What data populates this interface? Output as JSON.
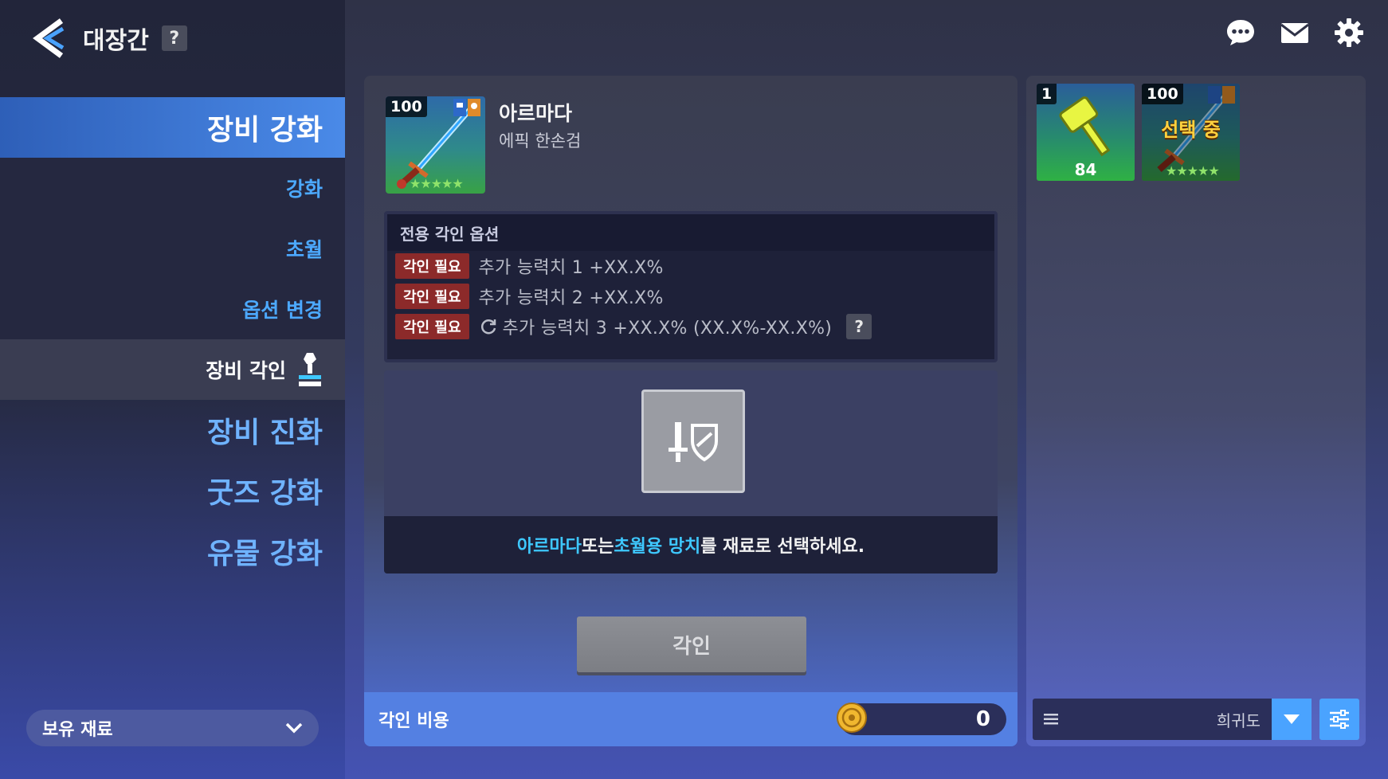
{
  "header": {
    "title": "대장간",
    "help": "?"
  },
  "sidebar": {
    "menu": [
      {
        "label": "장비 강화"
      },
      {
        "label": "강화"
      },
      {
        "label": "초월"
      },
      {
        "label": "옵션 변경"
      },
      {
        "label": "장비 각인"
      },
      {
        "label": "장비 진화"
      },
      {
        "label": "굿즈 강화"
      },
      {
        "label": "유물 강화"
      }
    ],
    "materials_label": "보유 재료"
  },
  "item": {
    "level": "100",
    "name": "아르마다",
    "type": "에픽 한손검",
    "stars": "★★★★★"
  },
  "options": {
    "header": "전용 각인 옵션",
    "rows": [
      {
        "tag": "각인 필요",
        "text": "추가 능력치 1  +XX.X%"
      },
      {
        "tag": "각인 필요",
        "text": "추가 능력치 2  +XX.X%"
      },
      {
        "tag": "각인 필요",
        "text": "추가 능력치 3  +XX.X% (XX.X%-XX.X%)"
      }
    ],
    "help": "?"
  },
  "slot": {
    "hint_name": "아르마다",
    "hint_mid": " 또는 ",
    "hint_hammer": "초월용 망치",
    "hint_end": "를 재료로 선택하세요."
  },
  "action": {
    "engrave_label": "각인"
  },
  "cost": {
    "label": "각인 비용",
    "value": "0"
  },
  "inventory": {
    "items": [
      {
        "badge": "1",
        "count": "84"
      },
      {
        "badge": "100",
        "stars": "★★★★★",
        "status": "선택 중"
      }
    ],
    "sort_label": "희귀도"
  },
  "colors": {
    "accent": "#4aa3ff",
    "highlight": "#3ec8ff",
    "tag_red": "#8c2a2a"
  }
}
